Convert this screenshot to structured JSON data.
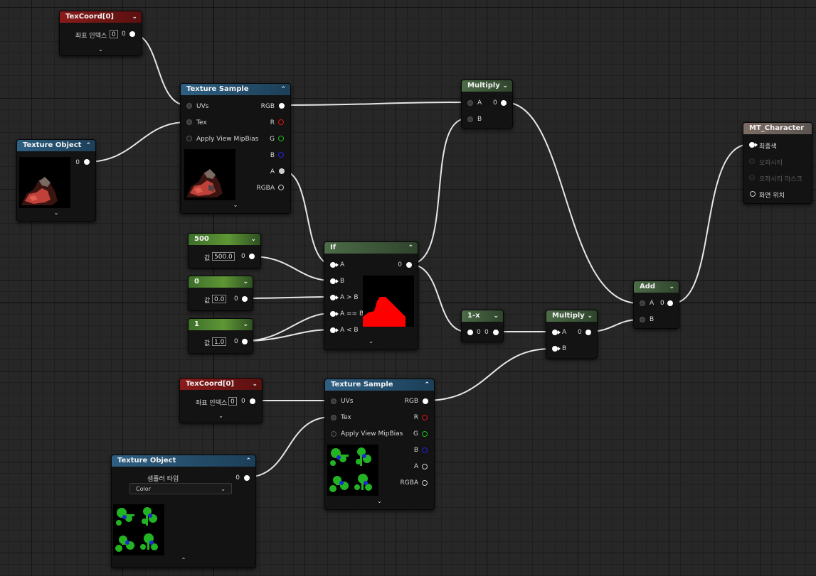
{
  "nodes": {
    "texcoord_top": {
      "title": "TexCoord[0]",
      "index_label": "좌표 인덱스",
      "index_value": "0",
      "out_pin": "0"
    },
    "texture_sample_top": {
      "title": "Texture Sample",
      "inputs": [
        "UVs",
        "Tex",
        "Apply View MipBias"
      ],
      "outputs": [
        "RGB",
        "R",
        "G",
        "B",
        "A",
        "RGBA"
      ]
    },
    "texture_object_top": {
      "title": "Texture Object",
      "out_pin": "0"
    },
    "const_500": {
      "title": "500",
      "value_label": "값",
      "value": "500.0",
      "out_pin": "0"
    },
    "const_0": {
      "title": "0",
      "value_label": "값",
      "value": "0.0",
      "out_pin": "0"
    },
    "const_1": {
      "title": "1",
      "value_label": "값",
      "value": "1.0",
      "out_pin": "0"
    },
    "if_node": {
      "title": "If",
      "inputs": [
        "A",
        "B",
        "A > B",
        "A == B",
        "A < B"
      ],
      "out_pin": "0"
    },
    "multiply_top": {
      "title": "Multiply",
      "inputs": [
        "A",
        "B"
      ],
      "a_value": "0"
    },
    "one_minus": {
      "title": "1-x",
      "in_pin": "0",
      "out_pin": "0"
    },
    "multiply_bottom": {
      "title": "Multiply",
      "inputs": [
        "A",
        "B"
      ],
      "a_value": "0"
    },
    "add_node": {
      "title": "Add",
      "inputs": [
        "A",
        "B"
      ],
      "a_value": "0"
    },
    "material_output": {
      "title": "MT_Character",
      "inputs": [
        "최종색",
        "오파시티",
        "오파시티 마스크",
        "화면 위치"
      ]
    },
    "texcoord_bottom": {
      "title": "TexCoord[0]",
      "index_label": "좌표 인덱스",
      "index_value": "0",
      "out_pin": "0"
    },
    "texture_sample_bottom": {
      "title": "Texture Sample",
      "inputs": [
        "UVs",
        "Tex",
        "Apply View MipBias"
      ],
      "outputs": [
        "RGB",
        "R",
        "G",
        "B",
        "A",
        "RGBA"
      ]
    },
    "texture_object_bottom": {
      "title": "Texture Object",
      "sampler_label": "샘플러 타입",
      "sampler_value": "Color",
      "out_pin": "0"
    }
  },
  "colors": {
    "pin_r": "#e01010",
    "pin_g": "#18c018",
    "pin_b": "#2222e0",
    "if_mask": "#ff0000"
  }
}
